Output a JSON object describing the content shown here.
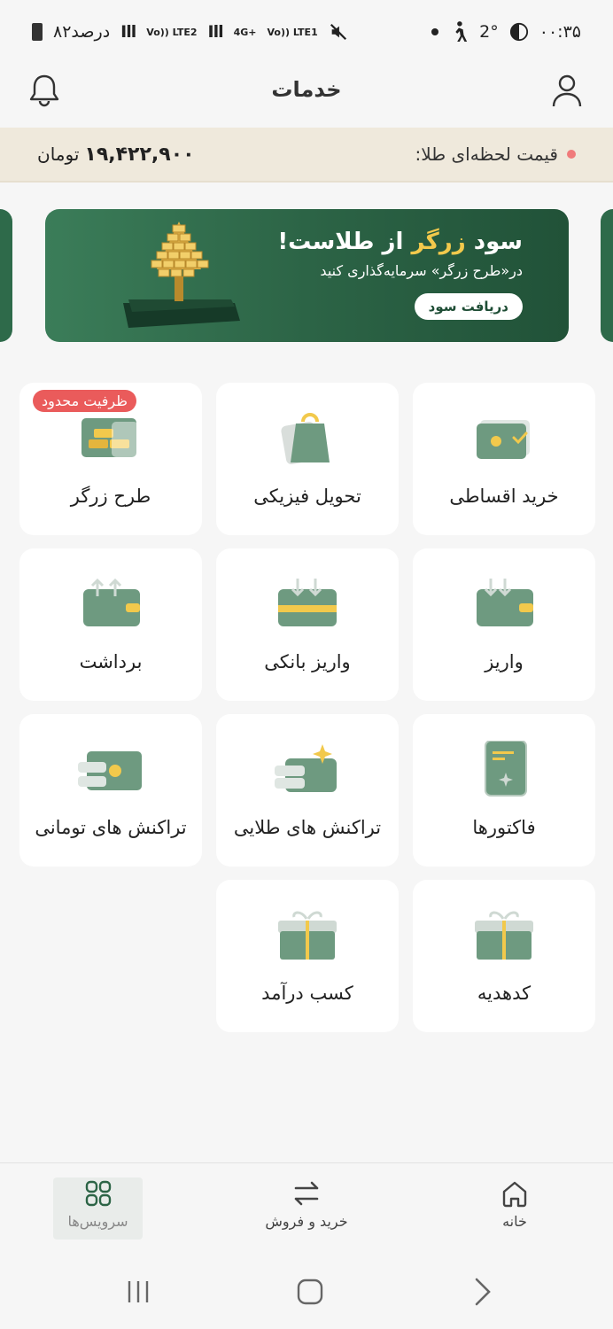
{
  "status_bar": {
    "time": "۰۰:۳۵",
    "temperature": "2°",
    "battery_text": "۸۲درصد",
    "sim1_label": "Vo)) LTE1",
    "sim2_label": "Vo)) LTE2",
    "network": "4G+"
  },
  "header": {
    "title": "خدمات"
  },
  "gold_price": {
    "label": "قیمت لحظه‌ای طلا:",
    "value": "۱۹,۴۲۲,۹۰۰",
    "unit": "تومان"
  },
  "banner": {
    "headline_prefix": "سود ",
    "headline_highlight": "زرگر",
    "headline_suffix": " از طلاست!",
    "subtext": "در«طرح زرگر» سرمایه‌گذاری کنید",
    "button_label": "دریافت سود"
  },
  "services": [
    {
      "label": "خرید اقساطی",
      "icon": "installment-card-icon"
    },
    {
      "label": "تحویل فیزیکی",
      "icon": "shopping-bag-icon"
    },
    {
      "label": "طرح زرگر",
      "icon": "gold-bars-icon",
      "badge": "ظرفیت محدود"
    },
    {
      "label": "واریز",
      "icon": "wallet-deposit-icon"
    },
    {
      "label": "واریز بانکی",
      "icon": "bank-card-deposit-icon"
    },
    {
      "label": "برداشت",
      "icon": "wallet-withdraw-icon"
    },
    {
      "label": "فاکتورها",
      "icon": "invoice-icon"
    },
    {
      "label": "تراکنش های طلایی",
      "icon": "gold-transactions-icon"
    },
    {
      "label": "تراکنش های تومانی",
      "icon": "toman-transactions-icon"
    },
    {
      "label": "کدهدیه",
      "icon": "gift-code-icon"
    },
    {
      "label": "کسب درآمد",
      "icon": "earn-income-icon"
    }
  ],
  "bottom_nav": [
    {
      "label": "خانه",
      "icon": "home-icon"
    },
    {
      "label": "خرید و فروش",
      "icon": "swap-arrows-icon"
    },
    {
      "label": "سرویس‌ها",
      "icon": "grid-icon",
      "active": true
    }
  ],
  "colors": {
    "primary_green": "#2c6446",
    "tile_green": "#6e9a80",
    "gold": "#f2c94c",
    "badge_red": "#ea5b5b",
    "price_strip_bg": "#efe9dc"
  }
}
